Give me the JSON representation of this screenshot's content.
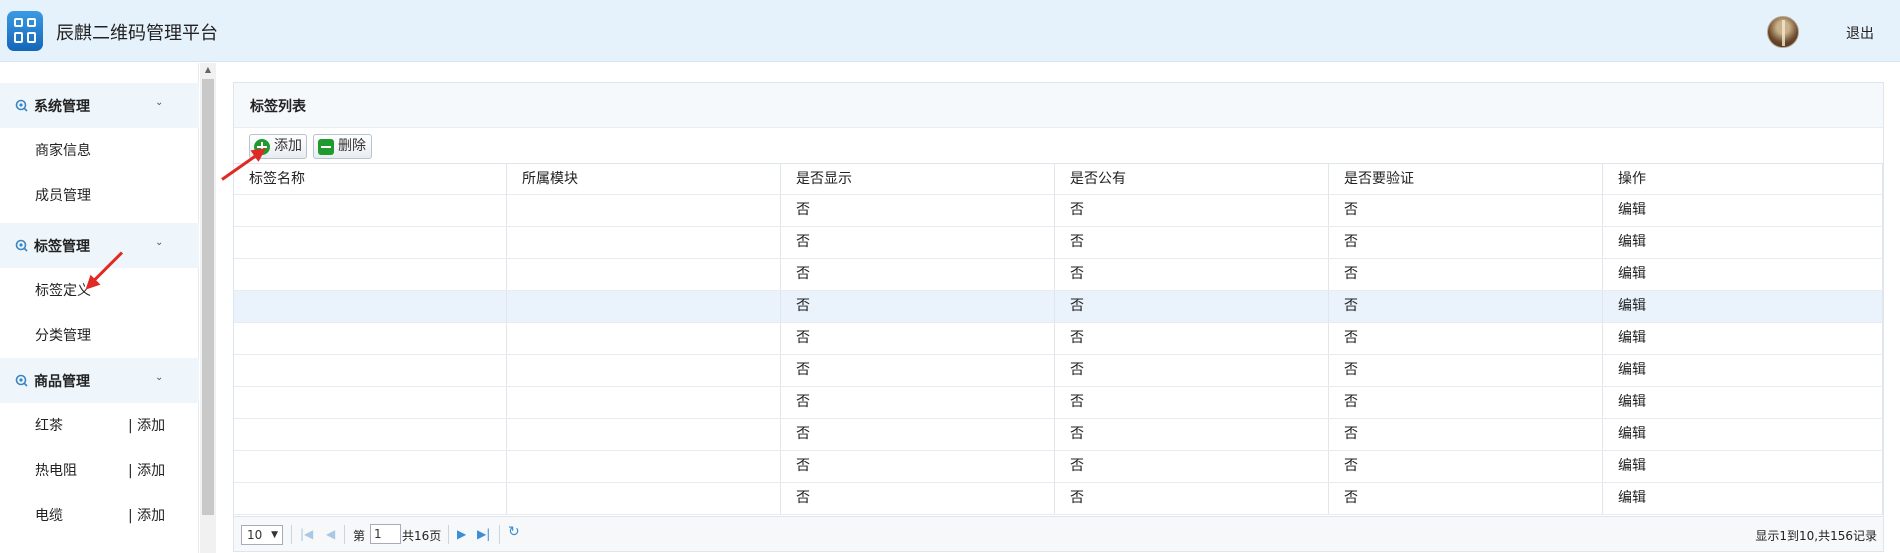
{
  "header": {
    "title": "辰麒二维码管理平台",
    "logout": "退出"
  },
  "sidebar": {
    "groups": [
      {
        "label": "系统管理",
        "items": [
          "商家信息",
          "成员管理"
        ]
      },
      {
        "label": "标签管理",
        "items": [
          "标签定义",
          "分类管理"
        ]
      },
      {
        "label": "商品管理",
        "items": [
          {
            "label": "红茶",
            "action": "| 添加"
          },
          {
            "label": "热电阻",
            "action": "| 添加"
          },
          {
            "label": "电缆",
            "action": "| 添加"
          }
        ]
      }
    ]
  },
  "panel": {
    "title": "标签列表",
    "add_label": "添加",
    "delete_label": "删除",
    "columns": [
      "标签名称",
      "所属模块",
      "是否显示",
      "是否公有",
      "是否要验证",
      "操作"
    ],
    "rows": [
      [
        "",
        "",
        "否",
        "否",
        "否",
        "编辑"
      ],
      [
        "",
        "",
        "否",
        "否",
        "否",
        "编辑"
      ],
      [
        "",
        "",
        "否",
        "否",
        "否",
        "编辑"
      ],
      [
        "",
        "",
        "否",
        "否",
        "否",
        "编辑"
      ],
      [
        "",
        "",
        "否",
        "否",
        "否",
        "编辑"
      ],
      [
        "",
        "",
        "否",
        "否",
        "否",
        "编辑"
      ],
      [
        "",
        "",
        "否",
        "否",
        "否",
        "编辑"
      ],
      [
        "",
        "",
        "否",
        "否",
        "否",
        "编辑"
      ],
      [
        "",
        "",
        "否",
        "否",
        "否",
        "编辑"
      ],
      [
        "",
        "",
        "否",
        "否",
        "否",
        "编辑"
      ]
    ],
    "highlighted_row": 3
  },
  "pager": {
    "page_size": "10",
    "page_prefix": "第",
    "page_value": "1",
    "page_suffix": "共16页",
    "info": "显示1到10,共156记录"
  }
}
